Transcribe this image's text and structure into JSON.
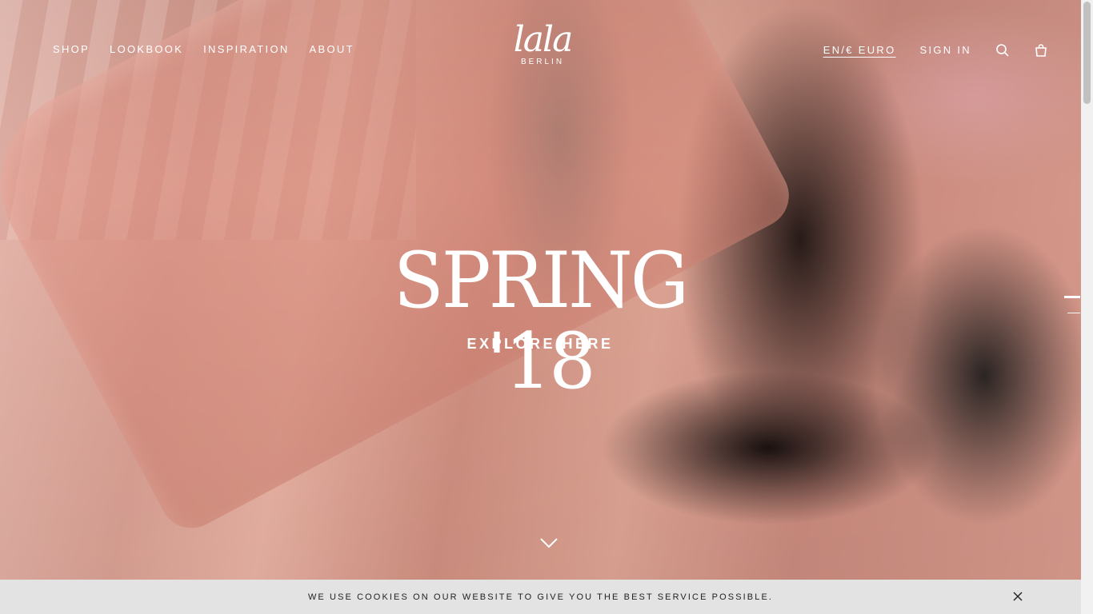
{
  "header": {
    "nav": [
      "SHOP",
      "LOOKBOOK",
      "INSPIRATION",
      "ABOUT"
    ],
    "logo": {
      "script": "lala",
      "sub": "BERLIN"
    },
    "language": "EN/€ EURO",
    "sign_in": "SIGN IN",
    "icons": [
      "search-icon",
      "shopping-bag-icon"
    ]
  },
  "hero": {
    "headline": "SPRING '18",
    "cta": "EXPLORE HERE",
    "icons": [
      "chevron-down-icon"
    ]
  },
  "cookie_bar": {
    "message": "WE USE COOKIES ON OUR WEBSITE TO GIVE YOU THE BEST SERVICE POSSIBLE.",
    "icons": [
      "close-icon"
    ]
  },
  "colors": {
    "text_on_hero": "#ffffff",
    "cookie_bg": "#e3e3e3",
    "cookie_text": "#222222"
  }
}
